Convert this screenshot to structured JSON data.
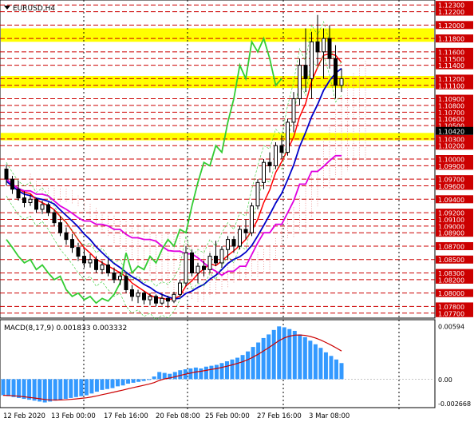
{
  "header": {
    "symbol": "EURUSD,H4",
    "menu_icon": "triangle-down-icon"
  },
  "macd": {
    "label": "MACD(8,17,9) 0.001833 0.003332"
  },
  "colors": {
    "up_candle": "#000000",
    "dn_candle": "#000000",
    "ma_red": "#ff0000",
    "ma_blue": "#0000c8",
    "ma_magenta": "#e000e0",
    "chikou_green": "#33cc33",
    "level_line": "#cc0000",
    "highlight_band": "#ffff00",
    "macd_hist": "#3399ff",
    "macd_signal": "#cc0000",
    "price_label_bg": "#cc0000",
    "current_price_bg": "#000000"
  },
  "price_axis": {
    "labels": [
      "1.12300",
      "1.12200",
      "1.12000",
      "1.11800",
      "1.11600",
      "1.11500",
      "1.11400",
      "1.11200",
      "1.11100",
      "1.10900",
      "1.10800",
      "1.10700",
      "1.10600",
      "1.10500",
      "1.10300",
      "1.10200",
      "1.10000",
      "1.09900",
      "1.09700",
      "1.09600",
      "1.09400",
      "1.09200",
      "1.09100",
      "1.09000",
      "1.08900",
      "1.08700",
      "1.08500",
      "1.08300",
      "1.08200",
      "1.08000",
      "1.07800",
      "1.07700"
    ],
    "current_price": "1.10420",
    "highlight_zones": [
      [
        1.1175,
        1.1195
      ],
      [
        1.1106,
        1.1124
      ],
      [
        1.1028,
        1.1039
      ]
    ]
  },
  "macd_axis": {
    "labels": [
      "0.00594",
      "0.00",
      "-0.002668"
    ]
  },
  "time_axis": {
    "labels": [
      "12 Feb 2020",
      "13 Feb 00:00",
      "17 Feb 16:00",
      "20 Feb 08:00",
      "25 Feb 00:00",
      "27 Feb 16:00",
      "3 Mar 08:00"
    ]
  },
  "chart_data": {
    "type": "candlestick",
    "symbol": "EURUSD",
    "timeframe": "H4",
    "ylim": [
      1.0765,
      1.1235
    ],
    "candles_ohlc_approx": [
      [
        1.0985,
        1.0992,
        1.096,
        1.097
      ],
      [
        1.097,
        1.0975,
        1.0948,
        1.0955
      ],
      [
        1.0955,
        1.0968,
        1.0938,
        1.0942
      ],
      [
        1.0942,
        1.0952,
        1.0928,
        1.0935
      ],
      [
        1.0935,
        1.0947,
        1.093,
        1.094
      ],
      [
        1.094,
        1.0942,
        1.092,
        1.0925
      ],
      [
        1.0925,
        1.0938,
        1.0918,
        1.0932
      ],
      [
        1.0932,
        1.0935,
        1.0915,
        1.092
      ],
      [
        1.092,
        1.0925,
        1.09,
        1.0905
      ],
      [
        1.0905,
        1.0915,
        1.0885,
        1.089
      ],
      [
        1.089,
        1.0898,
        1.0872,
        1.088
      ],
      [
        1.088,
        1.0888,
        1.086,
        1.0868
      ],
      [
        1.0868,
        1.0875,
        1.0848,
        1.0855
      ],
      [
        1.0855,
        1.0865,
        1.0838,
        1.0845
      ],
      [
        1.0845,
        1.0858,
        1.0838,
        1.085
      ],
      [
        1.085,
        1.0855,
        1.083,
        1.0835
      ],
      [
        1.0835,
        1.0848,
        1.0828,
        1.0842
      ],
      [
        1.0842,
        1.085,
        1.0825,
        1.083
      ],
      [
        1.083,
        1.0838,
        1.0815,
        1.082
      ],
      [
        1.082,
        1.0832,
        1.0812,
        1.0825
      ],
      [
        1.0825,
        1.083,
        1.08,
        1.0805
      ],
      [
        1.0805,
        1.0812,
        1.0788,
        1.0795
      ],
      [
        1.0795,
        1.0805,
        1.0785,
        1.08
      ],
      [
        1.08,
        1.0803,
        1.0783,
        1.079
      ],
      [
        1.079,
        1.08,
        1.0782,
        1.0795
      ],
      [
        1.0795,
        1.0798,
        1.078,
        1.0785
      ],
      [
        1.0785,
        1.0798,
        1.0782,
        1.0792
      ],
      [
        1.0792,
        1.0796,
        1.0778,
        1.0788
      ],
      [
        1.0788,
        1.0802,
        1.0785,
        1.0798
      ],
      [
        1.0798,
        1.082,
        1.0795,
        1.0815
      ],
      [
        1.0815,
        1.087,
        1.081,
        1.086
      ],
      [
        1.086,
        1.0865,
        1.0825,
        1.083
      ],
      [
        1.083,
        1.0845,
        1.0815,
        1.084
      ],
      [
        1.084,
        1.0848,
        1.0825,
        1.0835
      ],
      [
        1.0835,
        1.086,
        1.083,
        1.0855
      ],
      [
        1.0855,
        1.0878,
        1.084,
        1.0845
      ],
      [
        1.0845,
        1.087,
        1.0838,
        1.0865
      ],
      [
        1.0865,
        1.0885,
        1.085,
        1.088
      ],
      [
        1.088,
        1.0885,
        1.086,
        1.087
      ],
      [
        1.087,
        1.09,
        1.0865,
        1.0895
      ],
      [
        1.0895,
        1.091,
        1.088,
        1.089
      ],
      [
        1.089,
        1.0935,
        1.0885,
        1.093
      ],
      [
        1.093,
        1.097,
        1.0925,
        1.0965
      ],
      [
        1.0965,
        1.1,
        1.0955,
        1.0995
      ],
      [
        1.0995,
        1.101,
        1.098,
        1.099
      ],
      [
        1.099,
        1.1025,
        1.0985,
        1.102
      ],
      [
        1.102,
        1.1035,
        1.1,
        1.101
      ],
      [
        1.101,
        1.106,
        1.1005,
        1.1055
      ],
      [
        1.1055,
        1.11,
        1.104,
        1.109
      ],
      [
        1.109,
        1.115,
        1.108,
        1.114
      ],
      [
        1.114,
        1.1195,
        1.11,
        1.112
      ],
      [
        1.112,
        1.119,
        1.109,
        1.1175
      ],
      [
        1.1175,
        1.1215,
        1.114,
        1.116
      ],
      [
        1.116,
        1.1195,
        1.112,
        1.118
      ],
      [
        1.118,
        1.12,
        1.1135,
        1.115
      ],
      [
        1.115,
        1.117,
        1.109,
        1.111
      ],
      [
        1.111,
        1.1135,
        1.11,
        1.112
      ]
    ],
    "indicators": [
      "red MA",
      "blue MA",
      "magenta MA",
      "green chikou line",
      "cloud (dotted)"
    ],
    "macd_histogram_approx": [
      -0.0018,
      -0.0019,
      -0.002,
      -0.0021,
      -0.0022,
      -0.0023,
      -0.0024,
      -0.0025,
      -0.0026,
      -0.0025,
      -0.0024,
      -0.0023,
      -0.0022,
      -0.0021,
      -0.002,
      -0.0019,
      -0.0018,
      -0.0016,
      -0.0014,
      -0.0012,
      -0.0011,
      -0.001,
      -0.0008,
      -0.0007,
      -0.0005,
      -0.0004,
      -0.0003,
      -0.0002,
      0.0,
      0.0003,
      0.0008,
      0.0007,
      0.0006,
      0.0008,
      0.001,
      0.0011,
      0.0012,
      0.0013,
      0.0012,
      0.0014,
      0.0015,
      0.0016,
      0.0018,
      0.002,
      0.0022,
      0.0024,
      0.0027,
      0.0031,
      0.0036,
      0.0041,
      0.0046,
      0.005,
      0.0055,
      0.0059,
      0.0058,
      0.0056,
      0.0054,
      0.005,
      0.0047,
      0.0043,
      0.0039,
      0.0035,
      0.003,
      0.0026,
      0.0022,
      0.0018
    ],
    "macd_ylim": [
      -0.003,
      0.0062
    ]
  }
}
